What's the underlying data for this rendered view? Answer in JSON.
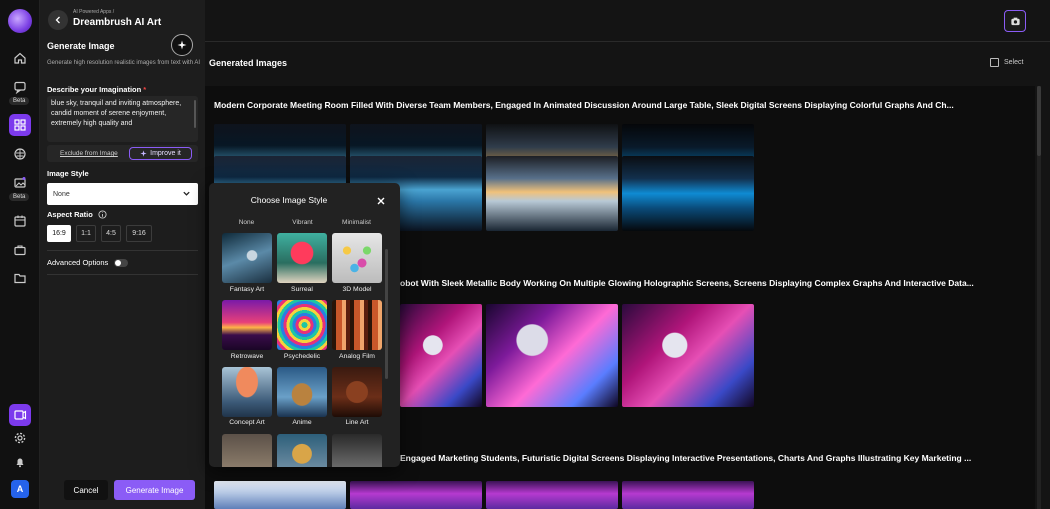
{
  "rail": {
    "beta_labels": [
      "Beta",
      "Beta"
    ],
    "avatar_initial": "A"
  },
  "panel": {
    "breadcrumb": "AI Powered Apps /",
    "app_title": "Dreambrush AI Art",
    "generate_title": "Generate Image",
    "generate_desc": "Generate high resolution realistic images from text with AI",
    "describe_label": "Describe your Imagination",
    "required_mark": "*",
    "prompt_text": "blue sky, tranquil and inviting atmosphere, candid moment of serene enjoyment, extremely high quality and",
    "exclude_link": "Exclude from Image",
    "improve_button": "Improve it",
    "style_label": "Image Style",
    "style_value": "None",
    "aspect_label": "Aspect Ratio",
    "ratios": [
      "16:9",
      "1:1",
      "4:5",
      "9:16"
    ],
    "selected_ratio": "16:9",
    "advanced_label": "Advanced Options",
    "cancel_button": "Cancel",
    "generate_button": "Generate Image"
  },
  "main": {
    "title": "Generated Images",
    "select_label": "Select",
    "rows": [
      {
        "title": "Modern Corporate Meeting Room Filled With Diverse Team Members, Engaged In Animated Discussion Around Large Table, Sleek Digital Screens Displaying Colorful Graphs And Ch..."
      },
      {
        "title": "obot With Sleek Metallic Body Working On Multiple Glowing Holographic Screens, Screens Displaying Complex Graphs And Interactive Data..."
      },
      {
        "title": "Engaged Marketing Students, Futuristic Digital Screens Displaying Interactive Presentations, Charts And Graphs Illustrating Key Marketing ..."
      }
    ]
  },
  "modal": {
    "title": "Choose Image Style",
    "column_heads": [
      "None",
      "Vibrant",
      "Minimalist"
    ],
    "styles": [
      "Fantasy Art",
      "Surreal",
      "3D Model",
      "Retrowave",
      "Psychedelic",
      "Analog Film",
      "Concept Art",
      "Anime",
      "Line Art"
    ]
  },
  "colors": {
    "accent": "#8b5cf6",
    "background": "#141414",
    "panel": "#1d1d1d"
  }
}
